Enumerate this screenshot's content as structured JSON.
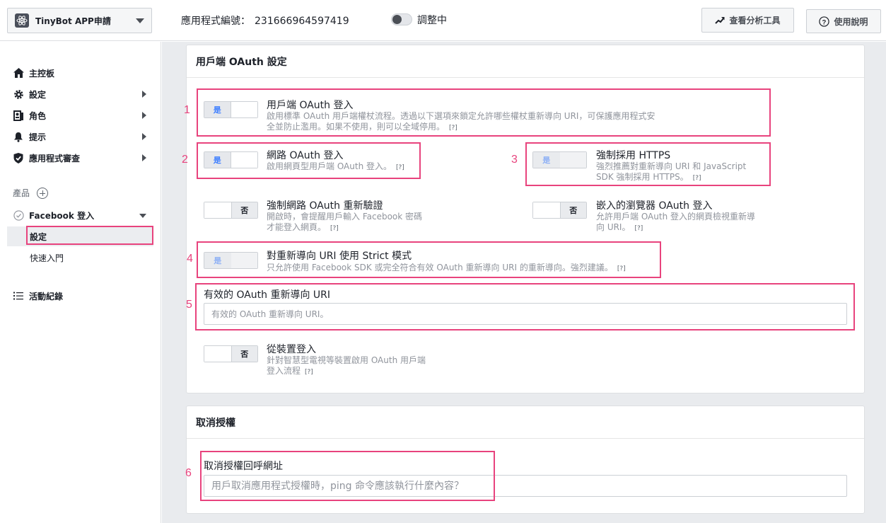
{
  "header": {
    "app_name": "TinyBot APP申請",
    "app_id_label": "應用程式編號：",
    "app_id_value": "231666964597419",
    "dev_status": "調整中",
    "analytics_label": "查看分析工具",
    "help_label": "使用說明"
  },
  "sidebar": {
    "items": [
      {
        "label": "主控板"
      },
      {
        "label": "設定"
      },
      {
        "label": "角色"
      },
      {
        "label": "提示"
      },
      {
        "label": "應用程式審查"
      }
    ],
    "products_label": "產品",
    "product": {
      "label": "Facebook 登入"
    },
    "sub_items": [
      {
        "label": "設定"
      },
      {
        "label": "快速入門"
      }
    ],
    "activity_label": "活動紀錄"
  },
  "oauth_card": {
    "title": "用戶端 OAuth 設定",
    "options": [
      {
        "num": "1",
        "title": "用戶端 OAuth 登入",
        "desc_line1": "啟用標準 OAuth 用戶端權杖流程。透過以下選項來鎖定允許哪些權杖重新導向 URI，可保護應用程式安",
        "desc_line2": "全並防止濫用。如果不使用，則可以全域停用。",
        "help": "[?]",
        "state": "是"
      },
      {
        "num": "2",
        "title": "網路 OAuth 登入",
        "desc_line1": "啟用網頁型用戶端 OAuth 登入。",
        "help": "[?]",
        "state": "是"
      },
      {
        "num": "3",
        "title": "強制採用 HTTPS",
        "desc_line1": "強烈推薦對重新導向 URI 和 JavaScript",
        "desc_line2": "SDK 強制採用 HTTPS。",
        "help": "[?]",
        "state": "是"
      },
      {
        "title": "強制網路 OAuth 重新驗證",
        "desc_line1": "開啟時，會提醒用戶輸入 Facebook 密碼",
        "desc_line2": "才能登入網頁。",
        "help": "[?]",
        "state": "否"
      },
      {
        "title": "嵌入的瀏覽器 OAuth 登入",
        "desc_line1": "允許用戶端 OAuth 登入的網頁檢視重新導",
        "desc_line2": "向 URI。",
        "help": "[?]",
        "state": "否"
      },
      {
        "num": "4",
        "title": "對重新導向 URI 使用 Strict 模式",
        "desc_line1": "只允許使用 Facebook SDK 或完全符合有效 OAuth 重新導向 URI 的重新導向。強烈建議。",
        "help": "[?]",
        "state": "是"
      },
      {
        "title": "從裝置登入",
        "desc_line1": "針對智慧型電視等裝置啟用 OAuth 用戶端",
        "desc_line2": "登入流程",
        "help": "[?]",
        "state": "否"
      }
    ],
    "redirect_field": {
      "num": "5",
      "label": "有效的 OAuth 重新導向 URI",
      "placeholder": "有效的 OAuth 重新導向 URI。"
    }
  },
  "deauth_card": {
    "title": "取消授權",
    "field": {
      "num": "6",
      "label": "取消授權回呼網址",
      "placeholder": "用戶取消應用程式授權時，ping 命令應該執行什麼內容？"
    }
  },
  "colors": {
    "highlight": "#e8437d",
    "accent": "#4080ff"
  }
}
